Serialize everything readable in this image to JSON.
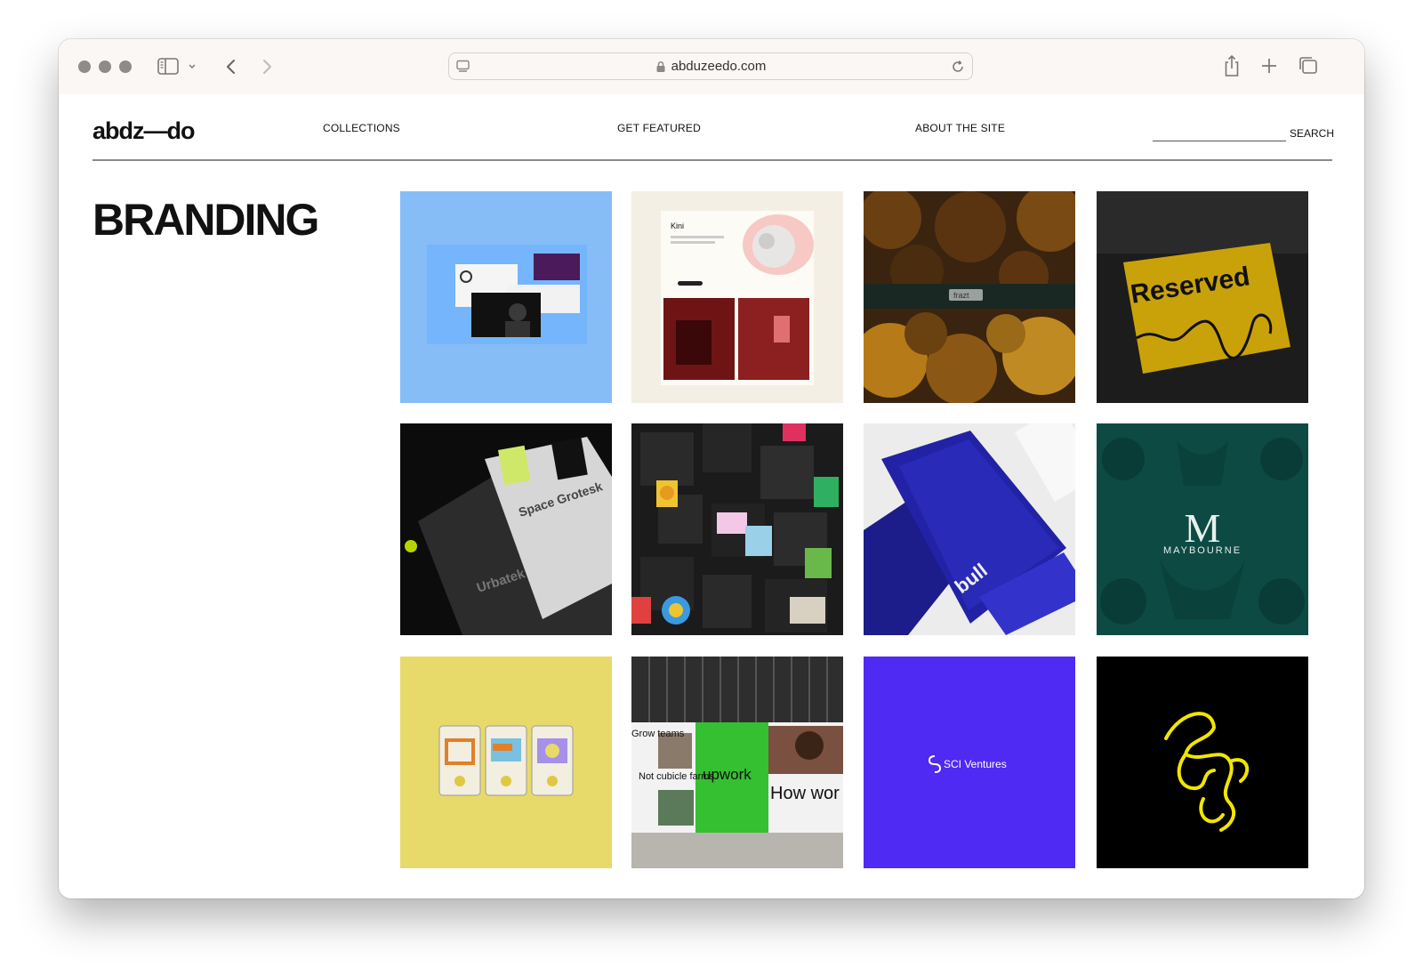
{
  "browser": {
    "url": "abduzeedo.com",
    "icons": {
      "sidebar": "sidebar-icon",
      "back": "chevron-left-icon",
      "forward": "chevron-right-icon",
      "lock": "lock-icon",
      "reload": "reload-icon",
      "share": "share-icon",
      "new_tab": "plus-icon",
      "tabs": "tabs-overview-icon"
    }
  },
  "site": {
    "logo": "abdz—do",
    "nav": {
      "collections": "COLLECTIONS",
      "get_featured": "GET FEATURED",
      "about": "ABOUT THE SITE"
    },
    "search": {
      "label": "SEARCH",
      "value": ""
    },
    "section_title": "BRANDING"
  },
  "tiles": [
    {
      "bg": "#86bdf7"
    },
    {
      "bg": "#f4efe4",
      "text": "Kini"
    },
    {
      "bg": "#2a1a0c",
      "text": "frazt"
    },
    {
      "bg": "#1c1c1c",
      "text": "Reserved"
    },
    {
      "bg": "#0c0c0c",
      "text_a": "Space Grotesk",
      "text_b": "Urbatek"
    },
    {
      "bg": "#1b1b1b"
    },
    {
      "bg": "#1a1a8c",
      "text": "bull"
    },
    {
      "bg": "#0d4a44",
      "text": "MAYBOURNE"
    },
    {
      "bg": "#e8da6a"
    },
    {
      "bg": "#3a3a3a",
      "text_a": "upwork",
      "text_b": "How wor should",
      "text_c": "Grow teams",
      "text_d": "Not cubicle farms"
    },
    {
      "bg": "#4f2af2",
      "text": "SCI Ventures"
    },
    {
      "bg": "#000000"
    }
  ],
  "colors": {
    "accent_yellow": "#f2e600",
    "chrome_bg": "#fbf7f4"
  }
}
